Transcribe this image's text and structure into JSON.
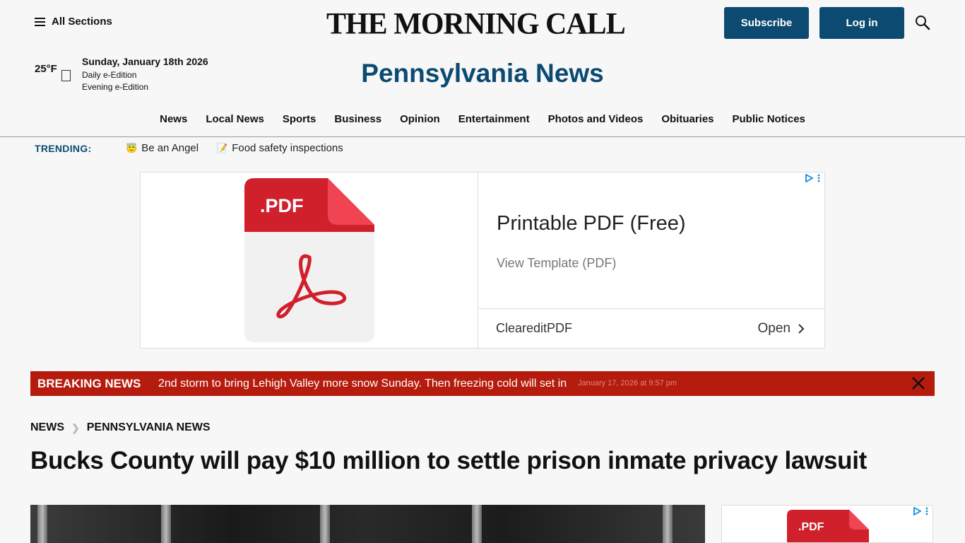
{
  "header": {
    "all_sections": "All Sections",
    "masthead": "THE MORNING CALL",
    "subscribe": "Subscribe",
    "login": "Log in"
  },
  "weather": {
    "temp": "25°F"
  },
  "date": {
    "today": "Sunday, January 18th 2026",
    "daily": "Daily e-Edition",
    "evening": "Evening e-Edition"
  },
  "section_title": "Pennsylvania News",
  "nav": {
    "items": [
      "News",
      "Local News",
      "Sports",
      "Business",
      "Opinion",
      "Entertainment",
      "Photos and Videos",
      "Obituaries",
      "Public Notices"
    ]
  },
  "trending": {
    "label": "TRENDING:",
    "items": [
      {
        "emoji": "😇",
        "label": "Be an Angel"
      },
      {
        "emoji": "📝",
        "label": "Food safety inspections"
      }
    ]
  },
  "ad": {
    "pdf_label": ".PDF",
    "title": "Printable PDF (Free)",
    "subtitle": "View Template (PDF)",
    "brand": "CleareditPDF",
    "open": "Open"
  },
  "breaking": {
    "label": "BREAKING NEWS",
    "text": "2nd storm to bring Lehigh Valley more snow Sunday. Then freezing cold will set in",
    "time": "January 17, 2026 at 9:57 pm"
  },
  "breadcrumb": [
    "NEWS",
    "PENNSYLVANIA NEWS"
  ],
  "headline": "Bucks County will pay $10 million to settle prison inmate privacy lawsuit",
  "side_ad": {
    "pdf_label": ".PDF"
  },
  "colors": {
    "brand": "#0c4a72",
    "breaking": "#b51c0e",
    "pdf_red": "#d0202c"
  }
}
